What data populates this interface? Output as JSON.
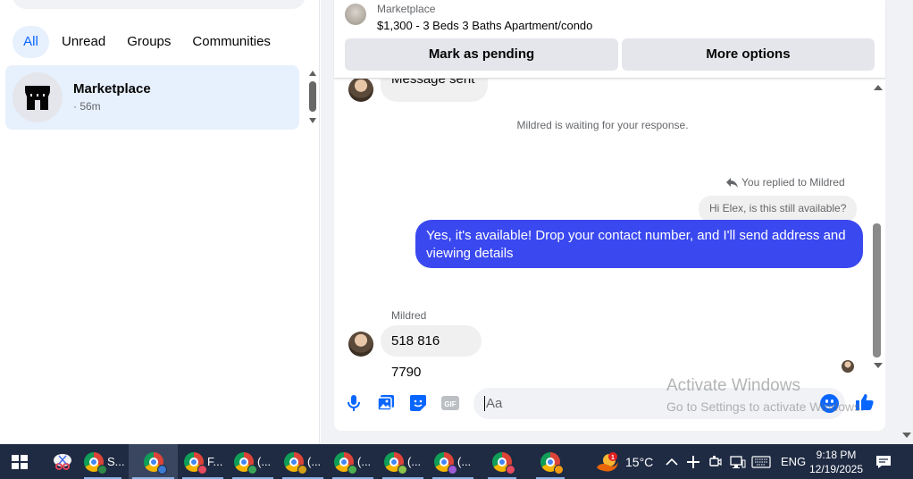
{
  "sidebar": {
    "tabs": [
      {
        "label": "All",
        "active": true
      },
      {
        "label": "Unread",
        "active": false
      },
      {
        "label": "Groups",
        "active": false
      },
      {
        "label": "Communities",
        "active": false
      }
    ],
    "conversation": {
      "title": "Marketplace",
      "time": "· 56m",
      "icon": "store-icon"
    }
  },
  "listing": {
    "label": "Marketplace",
    "title": "$1,300 - 3 Beds 3 Baths Apartment/condo",
    "mark_pending": "Mark as pending",
    "more_options": "More options"
  },
  "messages": {
    "partial_sent": "Message sent",
    "waiting_notice": "Mildred is waiting for your response.",
    "replied_label": "You replied to Mildred",
    "quoted_text": "Hi Elex, is this still available?",
    "my_reply": "Yes, it's available! Drop your contact number, and I'll send address and viewing details",
    "sender_name": "Mildred",
    "phone_message": "518 816 7790"
  },
  "composer": {
    "placeholder": "Aa",
    "icons": [
      "microphone-icon",
      "photo-icon",
      "sticker-icon",
      "gif-icon",
      "emoji-icon",
      "like-icon"
    ],
    "gif_label": "GIF"
  },
  "watermark": {
    "line1": "Activate Windows",
    "line2": "Go to Settings to activate Windows."
  },
  "taskbar": {
    "items": [
      {
        "label": "S..."
      },
      {
        "label": "F..."
      },
      {
        "label": "(..."
      },
      {
        "label": "(..."
      },
      {
        "label": "(..."
      },
      {
        "label": "(..."
      },
      {
        "label": "(..."
      }
    ],
    "weather": "15°C",
    "language": "ENG",
    "time": "9:18 PM",
    "date": "12/19/2025",
    "weather_badge": "1"
  },
  "colors": {
    "accent": "#0866ff",
    "my_bubble": "#3a48f0",
    "taskbar": "#1f2b43"
  }
}
